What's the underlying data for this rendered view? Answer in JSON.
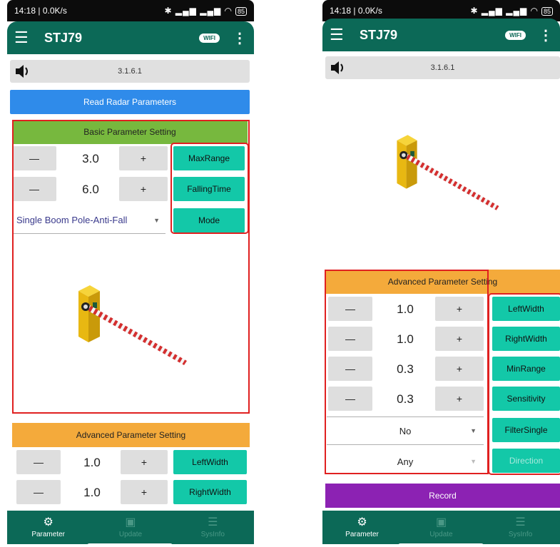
{
  "status": {
    "time_speed": "14:18 | 0.0K/s",
    "signal": "✱ ▂▄▆ ▂▄▆ ◠",
    "battery": "85"
  },
  "app": {
    "title": "STJ79",
    "wifi_label": "WIFI",
    "version": "3.1.6.1"
  },
  "buttons": {
    "read_radar": "Read Radar Parameters",
    "record": "Record"
  },
  "basic": {
    "header": "Basic Parameter Setting",
    "rows": [
      {
        "minus": "—",
        "value": "3.0",
        "plus": "+",
        "action": "MaxRange"
      },
      {
        "minus": "—",
        "value": "6.0",
        "plus": "+",
        "action": "FallingTime"
      }
    ],
    "mode_select": "Single Boom Pole-Anti-Fall",
    "mode_button": "Mode"
  },
  "advanced": {
    "header": "Advanced Parameter Setting",
    "rows": [
      {
        "minus": "—",
        "value": "1.0",
        "plus": "+",
        "action": "LeftWidth"
      },
      {
        "minus": "—",
        "value": "1.0",
        "plus": "+",
        "action": "RightWidth"
      },
      {
        "minus": "—",
        "value": "0.3",
        "plus": "+",
        "action": "MinRange"
      },
      {
        "minus": "—",
        "value": "0.3",
        "plus": "+",
        "action": "Sensitivity"
      }
    ],
    "filter_select": "No",
    "filter_button": "FilterSingle",
    "direction_select": "Any",
    "direction_button": "Direction"
  },
  "nav": [
    {
      "label": "Parameter",
      "icon": "gear-icon"
    },
    {
      "label": "Update",
      "icon": "update-icon"
    },
    {
      "label": "SysInfo",
      "icon": "sliders-icon"
    }
  ],
  "colors": {
    "appbar": "#0c6957",
    "teal_button": "#13c8a8",
    "basic_header": "#77b83e",
    "advanced_header": "#f4aa3b",
    "read_button": "#2f8bea",
    "record_button": "#8c22b3",
    "highlight": "#e02020"
  }
}
